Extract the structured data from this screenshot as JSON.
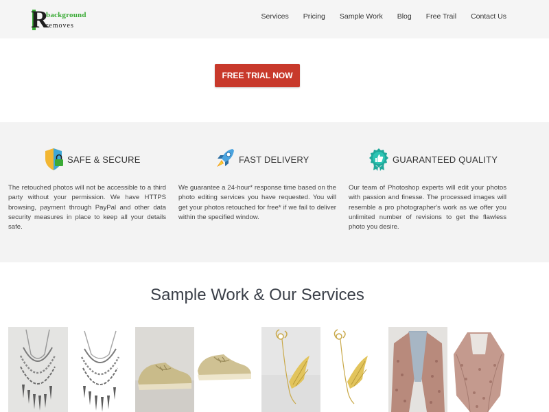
{
  "brand": {
    "logo_letter": "R",
    "logo_line1": "background",
    "logo_line2": "removes",
    "accent": "#3aaa35"
  },
  "nav": {
    "items": [
      "Services",
      "Pricing",
      "Sample Work",
      "Blog",
      "Free Trail",
      "Contact Us"
    ]
  },
  "cta": {
    "label": "FREE TRIAL NOW",
    "color": "#c8392b"
  },
  "features": [
    {
      "icon": "shield-lock-icon",
      "title": "SAFE & SECURE",
      "text": "The retouched photos will not be accessible to a third party without your permission. We have HTTPS browsing, payment through PayPal and other data security measures in place to keep all your details safe."
    },
    {
      "icon": "rocket-icon",
      "title": "FAST DELIVERY",
      "text": "We guarantee a 24-hour* response time based on the photo editing services you have requested. You will get your photos retouched for free* if we fail to deliver within the specified window."
    },
    {
      "icon": "thumbs-up-badge-icon",
      "title": "GUARANTEED QUALITY",
      "text": "Our team of Photoshop experts will edit your photos with passion and finesse. The processed images will resemble a pro photographer's work as we offer you unlimited number of revisions to get the flawless photo you desire."
    }
  ],
  "samples": {
    "title": "Sample Work & Our Services",
    "items": [
      "necklace-before",
      "necklace-after",
      "shoes-before",
      "shoes-after",
      "earring-before",
      "earring-after",
      "shawl-before",
      "shawl-after"
    ]
  }
}
